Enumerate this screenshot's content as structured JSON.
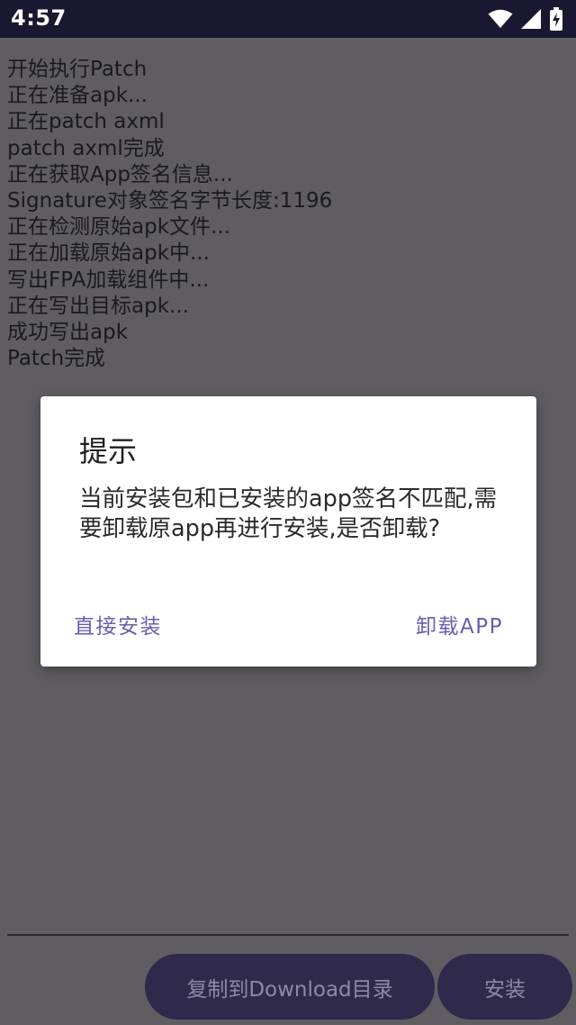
{
  "status_bar": {
    "time": "4:57",
    "icons": [
      "wifi-icon",
      "cellular-signal-icon",
      "battery-charging-icon"
    ]
  },
  "log": {
    "lines": [
      "开始执行Patch",
      "正在准备apk...",
      "正在patch axml",
      "patch axml完成",
      "正在获取App签名信息...",
      "Signature对象签名字节长度:1196",
      "正在检测原始apk文件...",
      "正在加载原始apk中...",
      "写出FPA加载组件中...",
      "正在写出目标apk...",
      "成功写出apk",
      "Patch完成"
    ]
  },
  "dialog": {
    "title": "提示",
    "message": "当前安装包和已安装的app签名不匹配,需要卸载原app再进行安装,是否卸载?",
    "negative_label": "直接安装",
    "positive_label": "卸载APP"
  },
  "bottom_bar": {
    "copy_label": "复制到Download目录",
    "install_label": "安装"
  },
  "colors": {
    "status_bar": "#1a1730",
    "scrim_background": "#5f5d61",
    "dialog_action": "#6a5cb0",
    "pill_button": "#2f2a4c"
  }
}
